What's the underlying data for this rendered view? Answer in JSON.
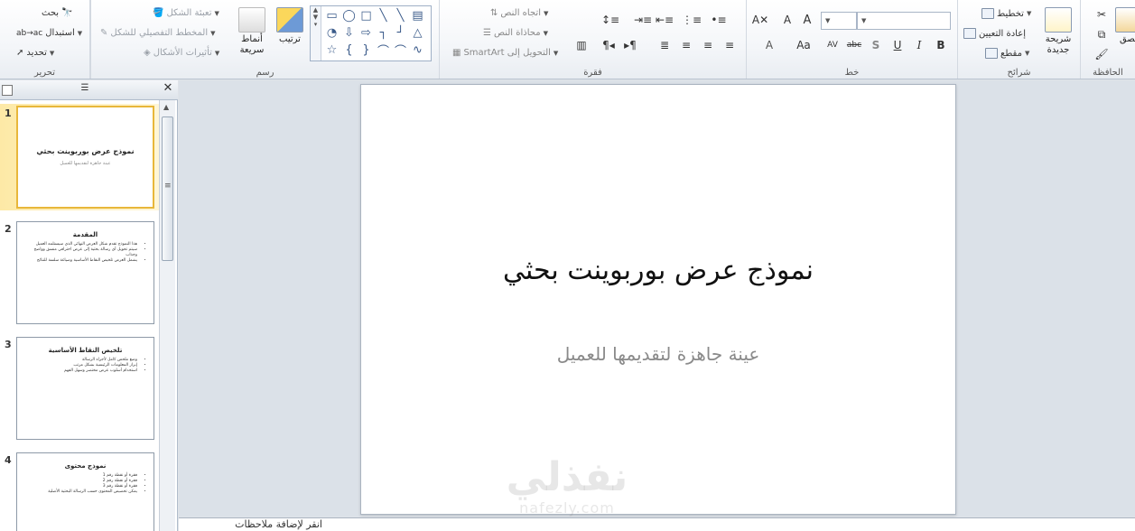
{
  "ribbon": {
    "groups": {
      "clipboard": "الحافظة",
      "slides": "شرائح",
      "font": "خط",
      "paragraph": "فقرة",
      "drawing": "رسم",
      "editing": "تحرير"
    },
    "clipboard": {
      "paste": "لصق"
    },
    "slides": {
      "new_slide": "شريحة جديدة",
      "layout": "تخطيط",
      "reset": "إعادة التعيين",
      "section": "مقطع"
    },
    "font": {
      "font_name": "",
      "font_size": "",
      "bold": "B",
      "italic": "I",
      "underline": "U",
      "shadow": "S",
      "strike": "abc",
      "spacing": "AV",
      "change_case": "Aa",
      "color": "A",
      "grow": "A",
      "shrink": "A"
    },
    "paragraph": {
      "text_direction": "اتجاه النص",
      "align_text": "محاذاة النص",
      "convert_smartart": "التحويل إلى SmartArt"
    },
    "drawing": {
      "arrange": "ترتيب",
      "quick_styles": "أنماط سريعة",
      "shape_fill": "تعبئة الشكل",
      "shape_outline": "المخطط التفصيلي للشكل",
      "shape_effects": "تأثيرات الأشكال"
    },
    "editing": {
      "find": "بحث",
      "replace": "استبدال",
      "select": "تحديد"
    }
  },
  "panel": {
    "slides": [
      {
        "num": "1",
        "title": "نموذج عرض بوربوينت بحثي",
        "subtitle": "عينة جاهزة لتقديمها للعميل",
        "bullets": []
      },
      {
        "num": "2",
        "title": "المقدمة",
        "subtitle": "",
        "bullets": [
          "هذا النموذج تقدم شكل العرض النهائي الذي سيستلمه العميل",
          "سيتم تحويل أي رسالة بحثية إلى عرض احترافي منسق وواضح وجذاب",
          "يشمل العرض تلخيص النقاط الأساسية وصياغة سلسة للنتائج"
        ]
      },
      {
        "num": "3",
        "title": "تلخيص النقاط الأساسية",
        "subtitle": "",
        "bullets": [
          "وضع ملخص كامل لأجزاء الرسالة",
          "إبراز المعلومات الرئيسية بشكل مرتب",
          "استخدام أسلوب عرض مختصر وسهل الفهم"
        ]
      },
      {
        "num": "4",
        "title": "نموذج محتوى",
        "subtitle": "",
        "bullets": [
          "فقرة أو نقطة رقم 1",
          "فقرة أو نقطة رقم 2",
          "فقرة أو نقطة رقم 3",
          "يمكن تخصيص المحتوى حسب الرسالة البحثية الأصلية"
        ]
      }
    ]
  },
  "slide": {
    "title": "نموذج عرض بوربوينت بحثي",
    "subtitle": "عينة جاهزة لتقديمها للعميل"
  },
  "notes": {
    "placeholder": "انقر لإضافة ملاحظات"
  },
  "watermark": {
    "logo": "نفذلي",
    "domain": "nafezly.com"
  }
}
